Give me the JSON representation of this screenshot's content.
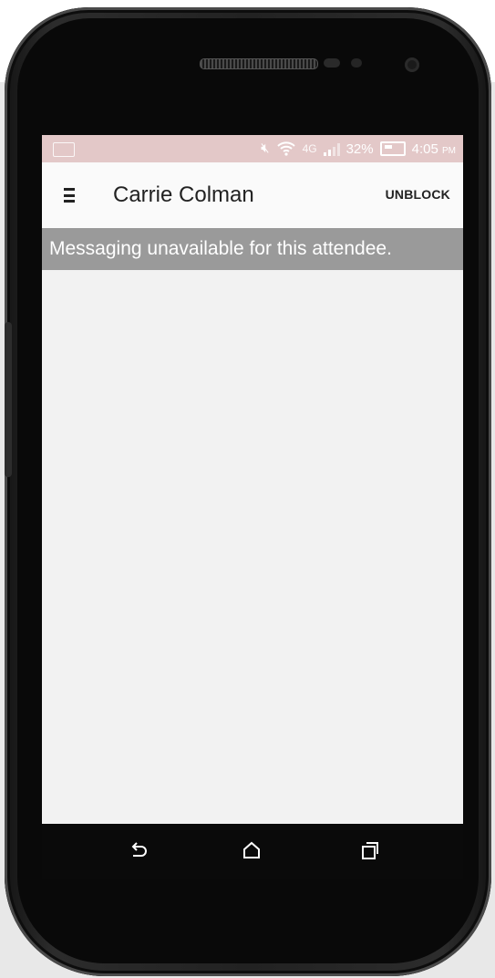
{
  "status_bar": {
    "battery_percent": "32%",
    "time": "4:05",
    "am_pm": "PM",
    "network": "4G",
    "icons": [
      "keyboard-icon",
      "mute-icon",
      "wifi-icon",
      "signal-icon",
      "battery-charging-icon"
    ]
  },
  "app_bar": {
    "title": "Carrie Colman",
    "action_label": "UNBLOCK"
  },
  "banner": {
    "message": "Messaging unavailable for this attendee."
  },
  "nav_bar": {
    "icons": [
      "back-icon",
      "home-icon",
      "recent-apps-icon"
    ]
  },
  "colors": {
    "status_bar_bg": "#e3c8c8",
    "app_bar_bg": "#fafafa",
    "banner_bg": "#9a9a9a",
    "content_bg": "#f2f2f2"
  }
}
